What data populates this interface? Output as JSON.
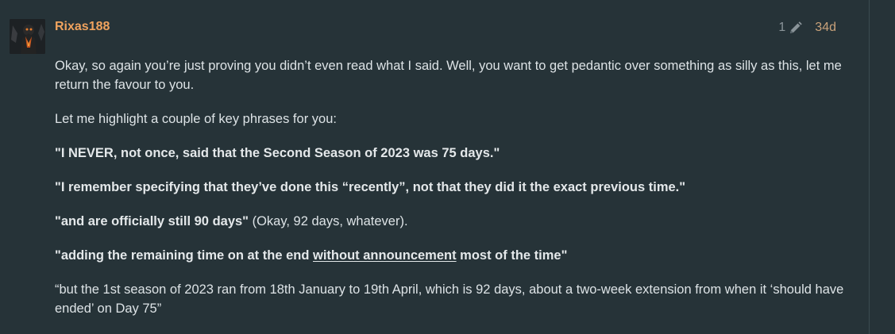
{
  "post": {
    "username": "Rixas188",
    "edit_count": "1",
    "age": "34d",
    "paragraphs": {
      "p1": "Okay, so again you’re just proving you didn’t even read what I said. Well, you want to get pedantic over something as silly as this, let me return the favour to you.",
      "p2": "Let me highlight a couple of key phrases for you:",
      "p3": "\"I NEVER, not once, said that the Second Season of 2023 was 75 days.\"",
      "p4": "\"I remember specifying that they’ve done this “recently”, not that they did it the exact previous time.\"",
      "p5_bold": "\"and are officially still 90 days\"",
      "p5_rest": " (Okay, 92 days, whatever).",
      "p6_pre": "\"adding the remaining time on at the end ",
      "p6_underlined": "without announcement",
      "p6_post": " most of the time\"",
      "p7": "“but the 1st season of 2023 ran from 18th January to 19th April, which is 92 days, about a two-week extension from when it ‘should have ended’ on Day 75”"
    }
  },
  "icons": {
    "avatar": "avatar-image",
    "edit": "pencil-icon"
  },
  "colors": {
    "background": "#263338",
    "username": "#f0a35e",
    "body_text": "#dde3e6",
    "meta_text": "#8a9499",
    "date_text": "#c9a27a"
  }
}
